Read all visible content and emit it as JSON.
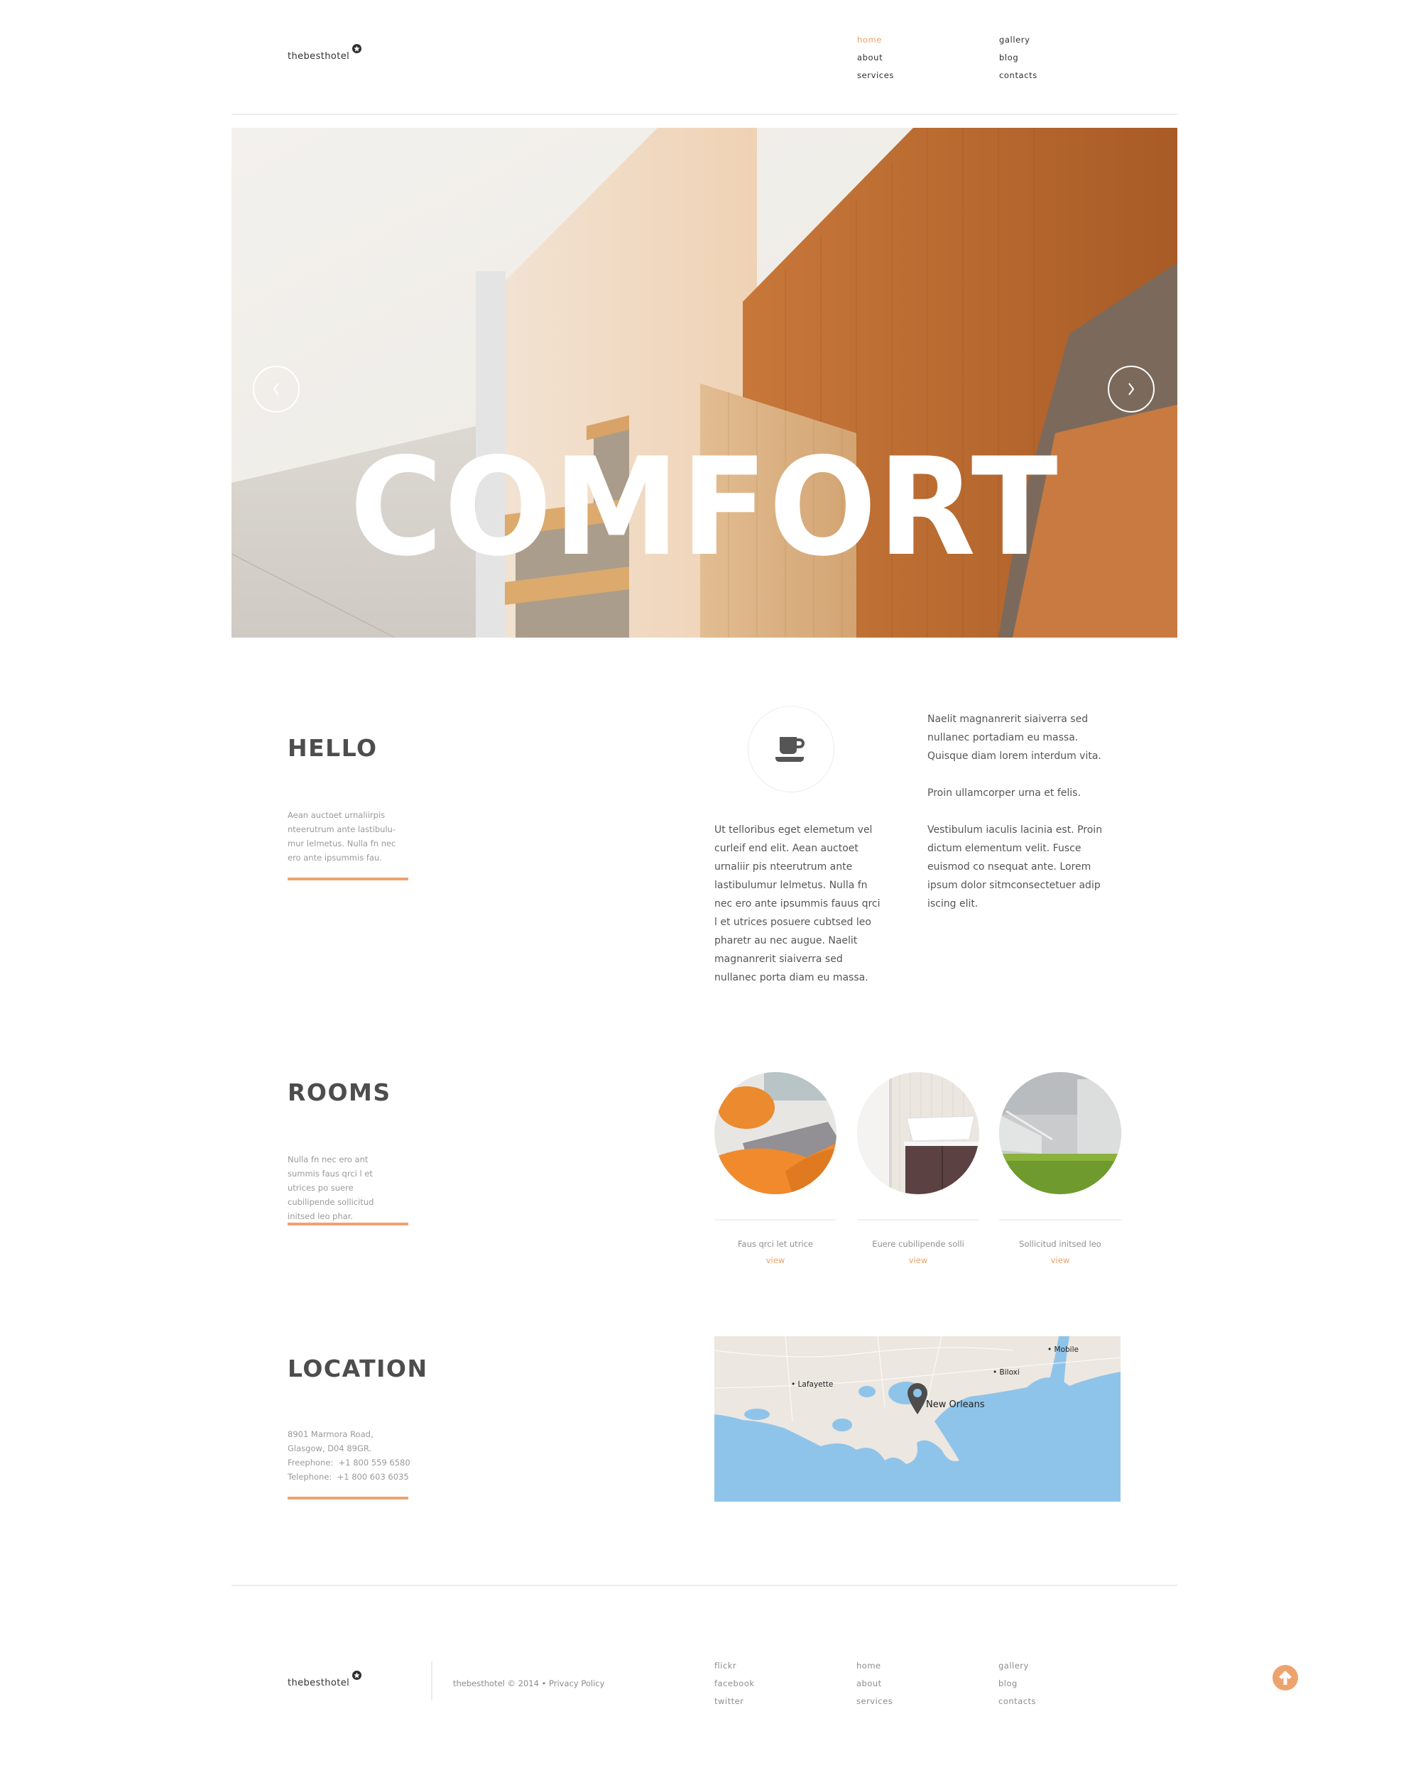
{
  "brand": {
    "name": "thebesthotel",
    "logo_icon": "star-badge-icon",
    "accent_color": "#eda36e",
    "link_color": "#e8a06a",
    "text_color": "#4d4d4d"
  },
  "header": {
    "nav": [
      {
        "label": "home",
        "active": true
      },
      {
        "label": "about",
        "active": false
      },
      {
        "label": "services",
        "active": false
      },
      {
        "label": "gallery",
        "active": false
      },
      {
        "label": "blog",
        "active": false
      },
      {
        "label": "contacts",
        "active": false
      }
    ]
  },
  "hero": {
    "title": "COMFORT",
    "prev_icon": "chevron-left-icon",
    "next_icon": "chevron-right-icon"
  },
  "hello": {
    "title": "HELLO",
    "intro": "Aean auctoet urnaliirpis nteerutrum ante lastibulu-mur lelmetus. Nulla fn nec ero ante ipsummis fau.",
    "icon": "coffee-cup-icon",
    "column1": "Ut telloribus eget elemetum vel curleif end elit. Aean auctoet urnaliir pis nteerutrum ante lastibulumur lelmetus. Nulla fn nec ero ante ipsummis fauus qrci l et utrices posuere cubtsed leo pharetr au nec augue. Naelit magnanrerit siaiverra sed nullanec porta diam eu massa.",
    "column2": [
      "Naelit magnanrerit siaiverra sed nullanec portadiam eu massa. Quisque diam lorem interdum vita.",
      "Proin ullamcorper urna et felis.",
      "Vestibulum iaculis lacinia est. Proin dictum elementum velit. Fusce euismod co nsequat ante. Lorem ipsum dolor sitmconsectetuer adip iscing elit."
    ]
  },
  "rooms": {
    "title": "ROOMS",
    "intro": "Nulla fn nec ero ant summis faus qrci l et utrices po suere cubilipende sollicitud initsed leo phar.",
    "items": [
      {
        "caption": "Faus qrci let utrice",
        "link": "view",
        "image": "orange-beanbag-lounge"
      },
      {
        "caption": "Euere cubilipende solli",
        "link": "view",
        "image": "bathroom-sink"
      },
      {
        "caption": "Sollicitud initsed leo",
        "link": "view",
        "image": "concrete-stairs-grass"
      }
    ]
  },
  "location": {
    "title": "LOCATION",
    "address_line1": "8901 Marmora Road,",
    "address_line2": "Glasgow, D04 89GR.",
    "freephone_label": "Freephone:",
    "freephone": "+1 800 559 6580",
    "telephone_label": "Telephone:",
    "telephone": "+1 800 603 6035",
    "map": {
      "marker_icon": "map-pin-icon",
      "marker_label": "New Orleans",
      "cities": [
        "Lafayette",
        "Biloxi",
        "Mobile"
      ],
      "water_color": "#8fc4ea",
      "land_color": "#ece7e0"
    }
  },
  "footer": {
    "brand": "thebesthotel",
    "copyright": "thebesthotel © 2014 • ",
    "privacy": "Privacy Policy",
    "social": [
      "flickr",
      "facebook",
      "twitter"
    ],
    "nav_col1": [
      "home",
      "about",
      "services"
    ],
    "nav_col2": [
      "gallery",
      "blog",
      "contacts"
    ],
    "back_to_top_icon": "arrow-up-icon"
  }
}
